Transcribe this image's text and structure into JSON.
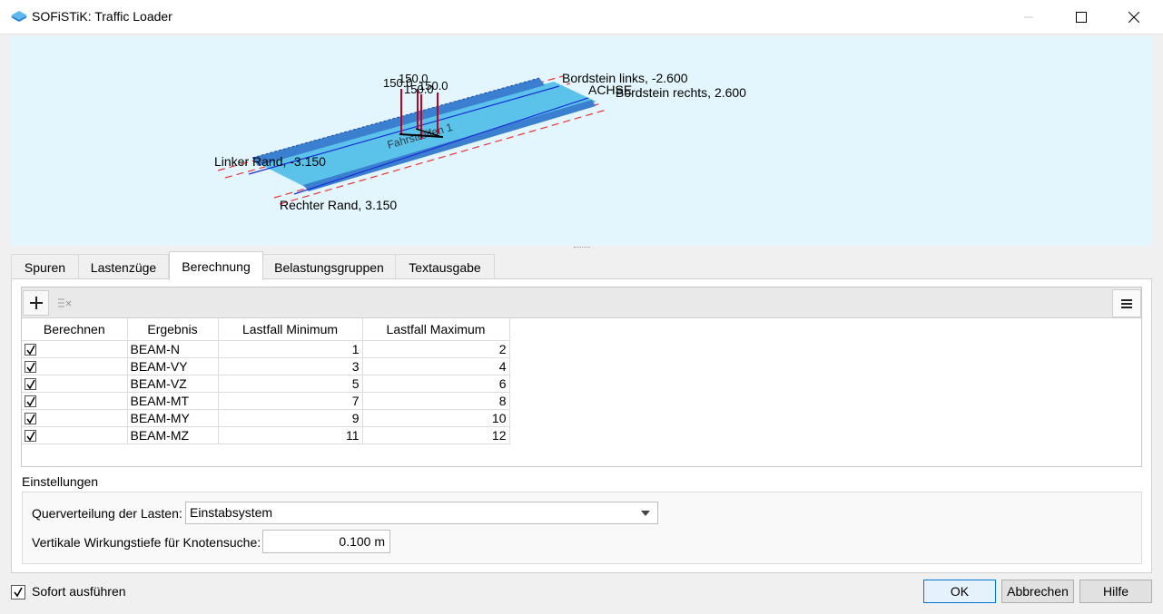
{
  "window": {
    "title": "SOFiSTiK: Traffic Loader"
  },
  "viewport": {
    "load_labels": [
      "150.0",
      "150.0",
      "150.0",
      "150.0"
    ],
    "curb_left": "Bordstein links, -2.600",
    "axis": "ACHSE",
    "curb_right": "Bordstein rechts, 2.600",
    "edge_left": "Linker Rand, -3.150",
    "edge_right": "Rechter  Rand, 3.150",
    "lane_label": "Fahrstreifen 1"
  },
  "tabs": [
    {
      "label": "Spuren",
      "active": false
    },
    {
      "label": "Lastenzüge",
      "active": false
    },
    {
      "label": "Berechnung",
      "active": true
    },
    {
      "label": "Belastungsgruppen",
      "active": false
    },
    {
      "label": "Textausgabe",
      "active": false
    }
  ],
  "grid": {
    "headers": [
      "Berechnen",
      "Ergebnis",
      "Lastfall Minimum",
      "Lastfall Maximum"
    ],
    "rows": [
      {
        "checked": true,
        "result": "BEAM-N",
        "min": "1",
        "max": "2"
      },
      {
        "checked": true,
        "result": "BEAM-VY",
        "min": "3",
        "max": "4"
      },
      {
        "checked": true,
        "result": "BEAM-VZ",
        "min": "5",
        "max": "6"
      },
      {
        "checked": true,
        "result": "BEAM-MT",
        "min": "7",
        "max": "8"
      },
      {
        "checked": true,
        "result": "BEAM-MY",
        "min": "9",
        "max": "10"
      },
      {
        "checked": true,
        "result": "BEAM-MZ",
        "min": "11",
        "max": "12"
      }
    ]
  },
  "settings": {
    "title": "Einstellungen",
    "distribution_label": "Querverteilung der Lasten:",
    "distribution_value": "Einstabsystem",
    "depth_label": "Vertikale Wirkungstiefe für Knotensuche:",
    "depth_value": "0.100 m"
  },
  "footer": {
    "run_immediately": "Sofort ausführen",
    "run_immediately_checked": true,
    "ok": "OK",
    "cancel": "Abbrechen",
    "help": "Hilfe"
  },
  "colors": {
    "viewport_bg": "#e3f6fd",
    "deck": "#5bc3ea",
    "beam": "#3a7fd0",
    "load_arrow": "#c0001f",
    "dashed_line": "#e8333a",
    "axis_line": "#1a2fd6"
  }
}
